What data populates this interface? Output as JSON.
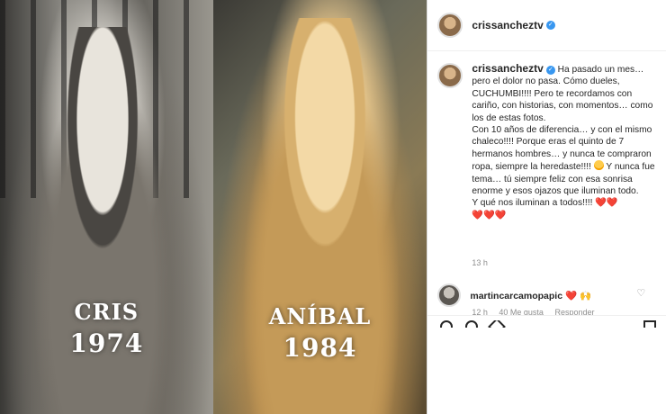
{
  "media": {
    "left": {
      "name": "CRIS",
      "year": "1974"
    },
    "right": {
      "name": "ANÍBAL",
      "year": "1984"
    }
  },
  "header": {
    "username": "crissancheztv"
  },
  "caption": {
    "username": "crissancheztv",
    "paragraphs": [
      "Ha pasado un mes… pero el dolor no pasa. Cómo dueles, CUCHUMBI!!!! Pero te recordamos con cariño, con historias, con momentos… como los de estas fotos.",
      "Con 10 años de diferencia… y con el mismo chaleco!!!! Porque eras el quinto de 7 hermanos hombres… y nunca te compraron ropa, siempre la heredaste!!!!",
      "Y nunca fue tema… tú siempre feliz con esa sonrisa enorme y esos ojazos que iluminan todo.",
      "Y qué nos iluminan a todos!!!!"
    ],
    "time_ago": "13 h"
  },
  "comment": {
    "username": "martincarcamopapic",
    "meta": {
      "time": "12 h",
      "likes": "40 Me gusta",
      "reply": "Responder"
    }
  },
  "icons": {
    "verified": "verified-badge-icon",
    "like": "heart-icon",
    "comment": "comment-icon",
    "share": "share-icon",
    "save": "bookmark-icon",
    "emoji": "grinning-face-icon",
    "pray": "folded-hands-icon"
  },
  "colors": {
    "verified": "#3897f0",
    "heart": "#ed4956",
    "text": "#262626",
    "muted": "#8e8e8e"
  }
}
